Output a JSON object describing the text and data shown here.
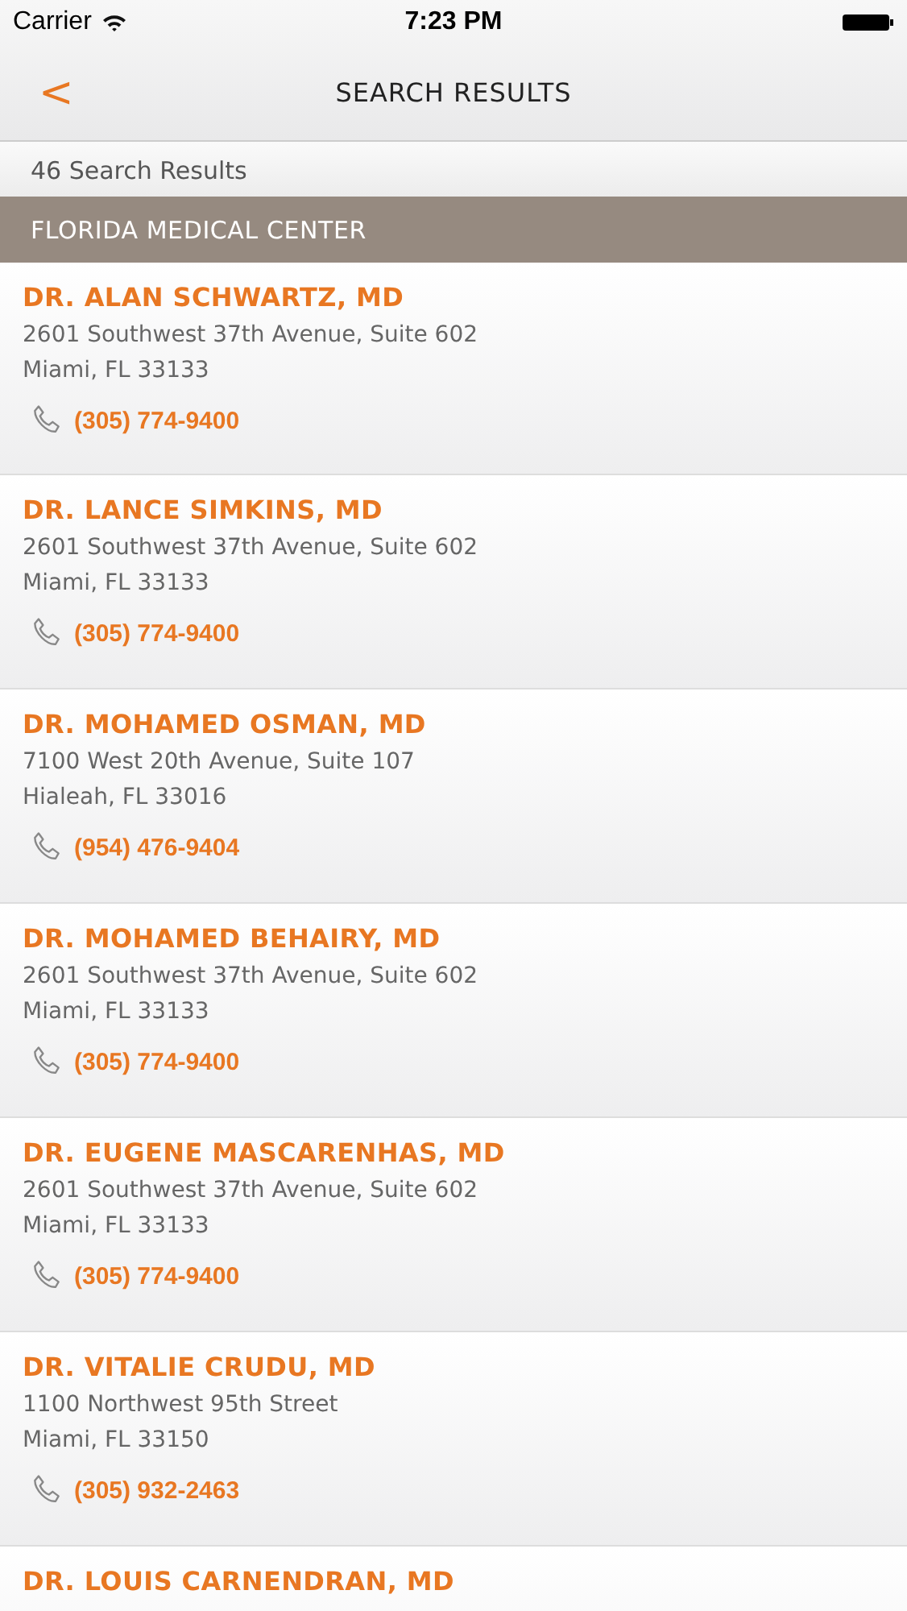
{
  "status_bar": {
    "carrier": "Carrier",
    "time": "7:23 PM"
  },
  "nav": {
    "back": "<",
    "title": "SEARCH RESULTS"
  },
  "result_count": "46 Search Results",
  "section": "FLORIDA MEDICAL CENTER",
  "results": [
    {
      "name": "DR. ALAN SCHWARTZ, MD",
      "address": "2601 Southwest 37th Avenue, Suite 602",
      "city": "Miami, FL 33133",
      "phone": "(305) 774-9400"
    },
    {
      "name": "DR. LANCE SIMKINS, MD",
      "address": "2601 Southwest 37th Avenue, Suite 602",
      "city": "Miami, FL 33133",
      "phone": "(305) 774-9400"
    },
    {
      "name": "DR. MOHAMED OSMAN, MD",
      "address": "7100 West 20th Avenue, Suite 107",
      "city": "Hialeah, FL 33016",
      "phone": "(954) 476-9404"
    },
    {
      "name": "DR. MOHAMED BEHAIRY, MD",
      "address": "2601 Southwest 37th Avenue, Suite 602",
      "city": "Miami, FL 33133",
      "phone": "(305) 774-9400"
    },
    {
      "name": "DR. EUGENE MASCARENHAS, MD",
      "address": "2601 Southwest 37th Avenue, Suite 602",
      "city": "Miami, FL 33133",
      "phone": "(305) 774-9400"
    },
    {
      "name": "DR. VITALIE CRUDU, MD",
      "address": "1100 Northwest 95th Street",
      "city": "Miami, FL 33150",
      "phone": "(305) 932-2463"
    },
    {
      "name": "DR. LOUIS CARNENDRAN, MD"
    }
  ]
}
